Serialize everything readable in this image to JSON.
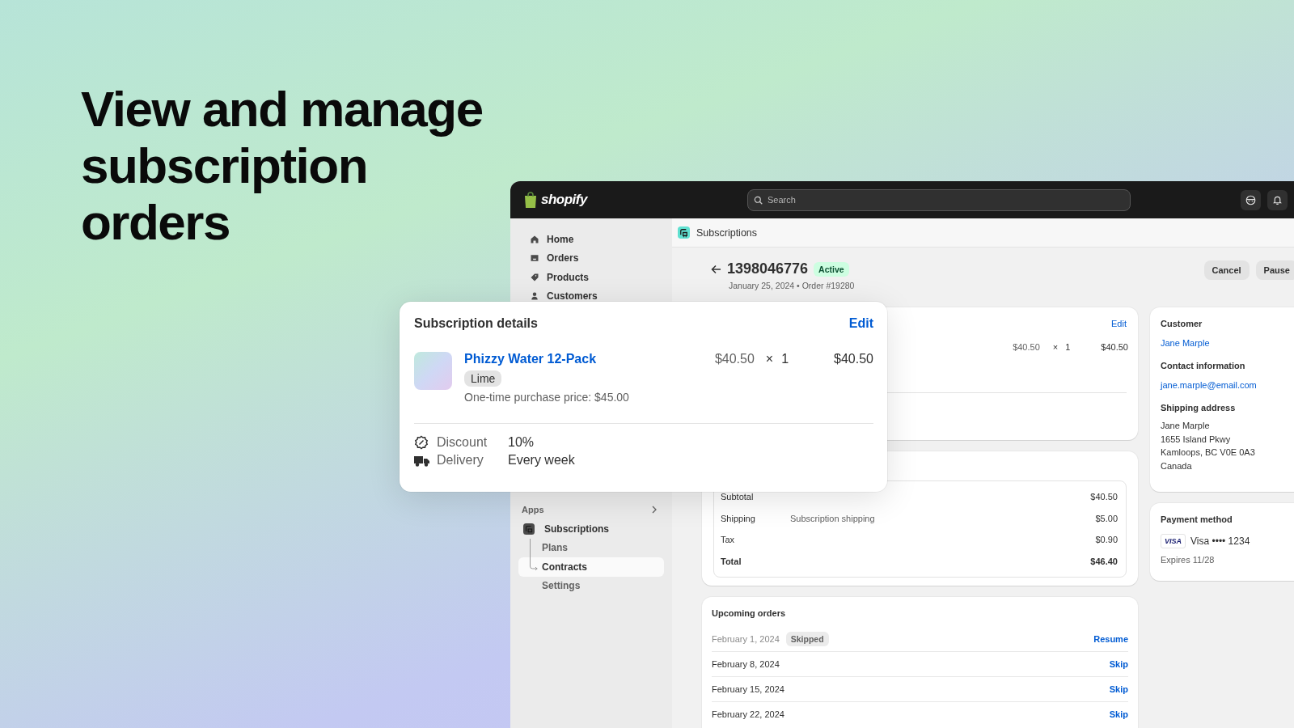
{
  "headline": "View and manage subscription orders",
  "topbar": {
    "logo": "shopify",
    "search": {
      "placeholder": "Search"
    }
  },
  "sidebar": {
    "items": [
      {
        "label": "Home",
        "selected": false
      },
      {
        "label": "Orders",
        "selected": false
      },
      {
        "label": "Products",
        "selected": false
      },
      {
        "label": "Customers",
        "selected": false
      }
    ],
    "apps": {
      "label": "Apps",
      "app": {
        "label": "Subscriptions",
        "children": [
          {
            "label": "Plans",
            "selected": false
          },
          {
            "label": "Contracts",
            "selected": true
          },
          {
            "label": "Settings",
            "selected": false
          }
        ]
      }
    }
  },
  "app_header": {
    "title": "Subscriptions"
  },
  "contract": {
    "number": "1398046776",
    "status": "Active",
    "subtitle": "January 25, 2024 • Order #19280",
    "actions": [
      "Cancel",
      "Pause"
    ]
  },
  "line_item_card": {
    "action": "Edit",
    "unit_price": "$40.50",
    "times": "×",
    "quantity": "1",
    "total": "$40.50"
  },
  "summary": {
    "rows": [
      {
        "label": "Subtotal",
        "detail": "",
        "amount": "$40.50",
        "kind": "line"
      },
      {
        "label": "Shipping",
        "detail": "Subscription shipping",
        "amount": "$5.00",
        "kind": "line"
      },
      {
        "label": "Tax",
        "detail": "",
        "amount": "$0.90",
        "kind": "line"
      },
      {
        "label": "Total",
        "detail": "",
        "amount": "$46.40",
        "kind": "total"
      }
    ]
  },
  "upcoming_orders": {
    "title": "Upcoming orders",
    "rows": [
      {
        "date": "February 1, 2024",
        "skipped": true,
        "badge": "Skipped",
        "action": "Resume"
      },
      {
        "date": "February 8, 2024",
        "skipped": false,
        "action": "Skip"
      },
      {
        "date": "February 15, 2024",
        "skipped": false,
        "action": "Skip"
      },
      {
        "date": "February 22, 2024",
        "skipped": false,
        "action": "Skip"
      }
    ]
  },
  "customer_card": {
    "sections": [
      {
        "heading": "Customer",
        "link": "Jane Marple"
      },
      {
        "heading": "Contact information",
        "link": "jane.marple@email.com"
      },
      {
        "heading": "Shipping address",
        "lines": [
          "Jane Marple",
          "1655 Island Pkwy",
          "Kamloops, BC V0E 0A3",
          "Canada"
        ]
      }
    ]
  },
  "payment_card": {
    "heading": "Payment method",
    "card_brand": "VISA",
    "card_label": "Visa •••• 1234",
    "expires": "Expires 11/28"
  },
  "details_popup": {
    "title": "Subscription details",
    "action": "Edit",
    "product": {
      "name": "Phizzy Water 12-Pack",
      "variant": "Lime",
      "note": "One-time purchase price: $45.00",
      "unit_price": "$40.50",
      "times": "×",
      "quantity": "1",
      "total": "$40.50"
    },
    "terms": [
      {
        "label": "Discount",
        "value": "10%"
      },
      {
        "label": "Delivery",
        "value": "Every week"
      }
    ]
  }
}
